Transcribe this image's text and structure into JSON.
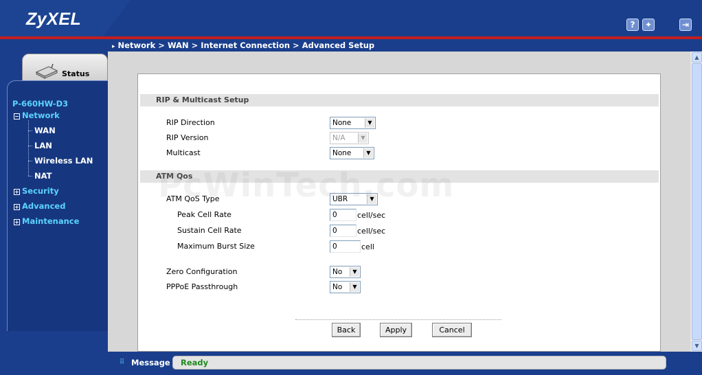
{
  "brand": {
    "logo": "ZyXEL"
  },
  "header": {
    "help_icon": "question-icon",
    "wizard_icon": "wizard-icon",
    "logout_icon": "logout-icon"
  },
  "breadcrumb": "Network > WAN > Internet Connection > Advanced Setup",
  "sidebar": {
    "status_tab": "Status",
    "device": "P-660HW-D3",
    "network": "Network",
    "network_items": [
      "WAN",
      "LAN",
      "Wireless LAN",
      "NAT"
    ],
    "security": "Security",
    "advanced": "Advanced",
    "maintenance": "Maintenance"
  },
  "rip": {
    "header": "RIP & Multicast Setup",
    "direction_label": "RIP Direction",
    "direction_value": "None",
    "version_label": "RIP Version",
    "version_value": "N/A",
    "multicast_label": "Multicast",
    "multicast_value": "None"
  },
  "atm": {
    "header": "ATM Qos",
    "type_label": "ATM QoS Type",
    "type_value": "UBR",
    "pcr_label": "Peak Cell Rate",
    "pcr_value": "0",
    "pcr_unit": "cell/sec",
    "scr_label": "Sustain Cell Rate",
    "scr_value": "0",
    "scr_unit": "cell/sec",
    "mbs_label": "Maximum Burst Size",
    "mbs_value": "0",
    "mbs_unit": "cell"
  },
  "misc": {
    "zero_label": "Zero Configuration",
    "zero_value": "No",
    "pppoe_label": "PPPoE Passthrough",
    "pppoe_value": "No"
  },
  "buttons": {
    "back": "Back",
    "apply": "Apply",
    "cancel": "Cancel"
  },
  "message": {
    "label": "Message",
    "text": "Ready"
  },
  "watermark": "PcWinTech.com"
}
